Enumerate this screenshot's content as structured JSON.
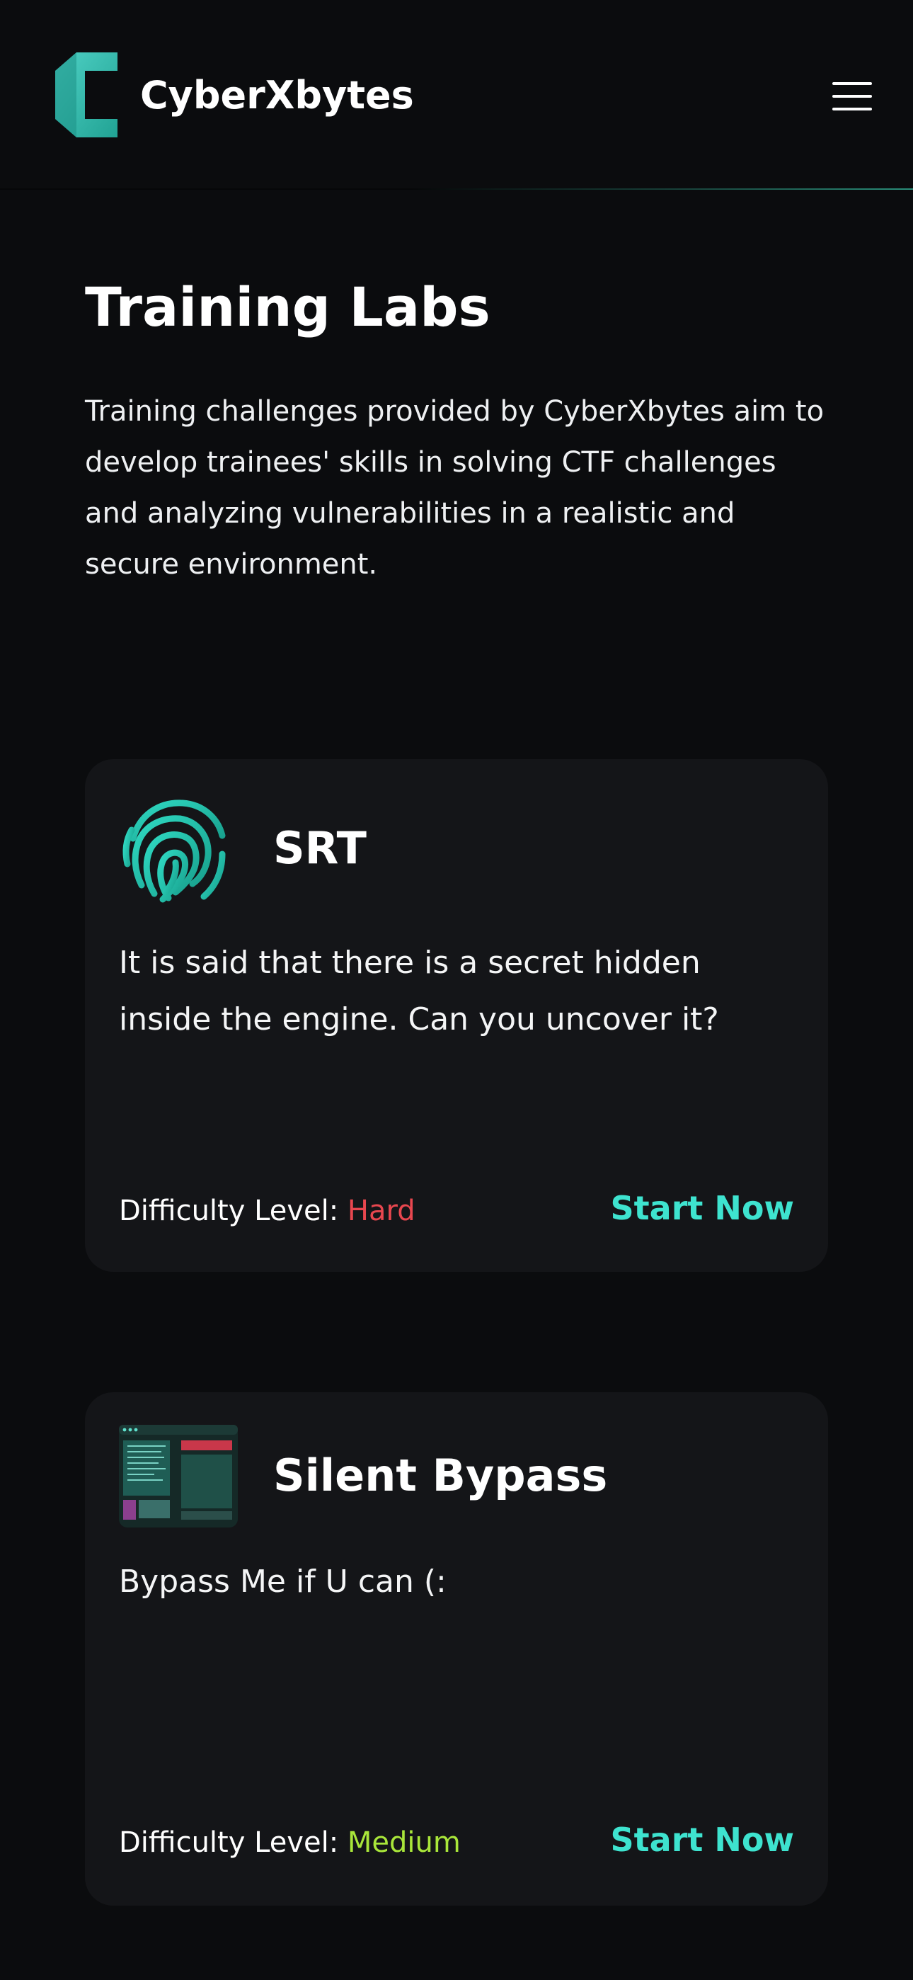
{
  "header": {
    "brand": "CyberXbytes",
    "logo_icon": "cyberxbytes-logo-icon",
    "menu_icon": "hamburger-menu-icon"
  },
  "intro": {
    "title": "Training Labs",
    "description": "Training challenges provided by CyberXbytes aim to develop trainees' skills in solving CTF challenges and analyzing vulnerabilities in a realistic and secure environment."
  },
  "labs": [
    {
      "title": "SRT",
      "icon": "fingerprint-icon",
      "description": "It is said that there is a secret hidden inside the engine. Can you uncover it?",
      "difficulty_label": "Difficulty Level:",
      "difficulty": "Hard",
      "cta": "Start Now"
    },
    {
      "title": "Silent Bypass",
      "icon": "dashboard-screenshot-icon",
      "description": "Bypass Me if U can (:",
      "difficulty_label": "Difficulty Level:",
      "difficulty": "Medium",
      "cta": "Start Now"
    }
  ],
  "colors": {
    "background": "#0b0c0e",
    "card": "#141518",
    "accent": "#3ee3cf",
    "hard": "#e8474f",
    "medium": "#a9e63a"
  }
}
